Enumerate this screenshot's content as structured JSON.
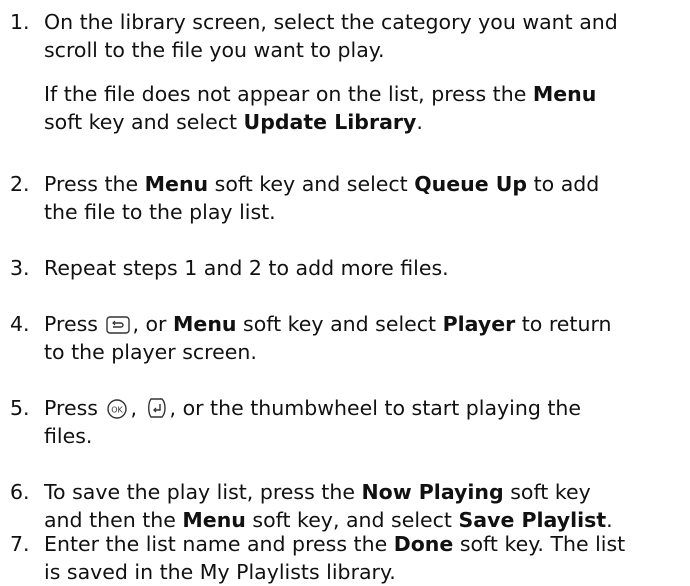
{
  "steps": [
    {
      "number": "1.",
      "line1": "On the library screen, select the category you want and",
      "line2": "scroll to the file you want to play.",
      "note": {
        "pre": "If the file does not appear on the list, press the ",
        "bold1": "Menu",
        "mid": "soft key and select ",
        "bold2": "Update Library",
        "post": "."
      }
    },
    {
      "number": "2.",
      "pre": "Press the ",
      "bold1": "Menu",
      "mid": " soft key and select ",
      "bold2": "Queue Up",
      "post": " to add",
      "line2": "the file to the play list."
    },
    {
      "number": "3.",
      "text": "Repeat steps 1 and 2 to add more files."
    },
    {
      "number": "4.",
      "pre": "Press ",
      "mid": ", or ",
      "bold1": "Menu",
      "mid2": " soft key and select ",
      "bold2": "Player",
      "post": " to return",
      "line2": "to the player screen."
    },
    {
      "number": "5.",
      "pre": "Press ",
      "sep": ", ",
      "post": ", or the thumbwheel to start playing the",
      "line2": "files."
    },
    {
      "number": "6.",
      "pre": "To save the play list, press the ",
      "bold1": "Now Playing",
      "post1": " soft key",
      "pre2": "and then the ",
      "bold2": "Menu",
      "mid2": " soft key, and select ",
      "bold3": "Save Playlist",
      "post2": "."
    },
    {
      "number": "7.",
      "pre": "Enter the list name and press the ",
      "bold1": "Done",
      "post": " soft key. The list",
      "line2": "is saved in the My Playlists library."
    }
  ],
  "icons": {
    "back_key": "back-key-icon",
    "ok_key": "ok-key-icon",
    "enter_key": "enter-key-icon"
  }
}
